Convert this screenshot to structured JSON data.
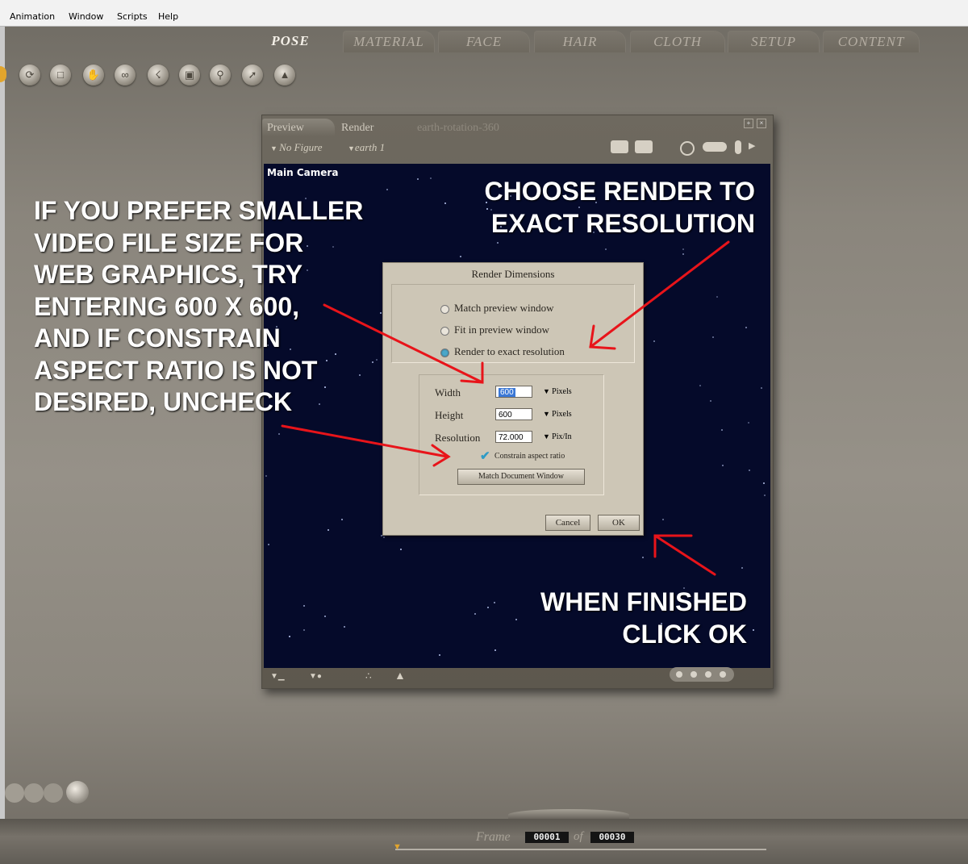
{
  "menu": [
    "Animation",
    "Window",
    "Scripts",
    "Help"
  ],
  "room_tabs": [
    {
      "label": "POSE",
      "active": true
    },
    {
      "label": "MATERIAL",
      "active": false
    },
    {
      "label": "FACE",
      "active": false
    },
    {
      "label": "HAIR",
      "active": false
    },
    {
      "label": "CLOTH",
      "active": false
    },
    {
      "label": "SETUP",
      "active": false
    },
    {
      "label": "CONTENT",
      "active": false
    }
  ],
  "tool_icons": [
    "rotate-icon",
    "grid-icon",
    "grab-icon",
    "chain-icon",
    "twist-icon",
    "translate-icon",
    "magnify-icon",
    "direct-manipulate-icon",
    "taper-icon"
  ],
  "doc_window": {
    "tabs": [
      "Preview",
      "Render"
    ],
    "doc_name": "earth-rotation-360",
    "figure_menu": "No Figure",
    "element_menu": "earth  1",
    "camera_label": "Main Camera"
  },
  "dialog": {
    "title": "Render Dimensions",
    "options": [
      {
        "label": "Match preview window",
        "selected": false
      },
      {
        "label": "Fit in preview window",
        "selected": false
      },
      {
        "label": "Render to exact resolution",
        "selected": true
      }
    ],
    "fields": [
      {
        "label": "Width",
        "value": "600",
        "unit": "Pixels"
      },
      {
        "label": "Height",
        "value": "600",
        "unit": "Pixels"
      },
      {
        "label": "Resolution",
        "value": "72.000",
        "unit": "Pix/In"
      }
    ],
    "constrain_label": "Constrain aspect ratio",
    "constrain_checked": true,
    "match_button": "Match Document Window",
    "cancel_button": "Cancel",
    "ok_button": "OK"
  },
  "annotations": {
    "left": [
      "IF YOU PREFER SMALLER",
      "VIDEO FILE SIZE FOR",
      "WEB GRAPHICS, TRY",
      "ENTERING 600 X 600,",
      "AND IF CONSTRAIN",
      "ASPECT RATIO IS NOT",
      "DESIRED, UNCHECK"
    ],
    "top_right": [
      "CHOOSE RENDER TO",
      "EXACT RESOLUTION"
    ],
    "bottom_right": [
      "WHEN FINISHED",
      "CLICK OK"
    ],
    "arrow_color": "#e8141a"
  },
  "timeline": {
    "frame_label": "Frame",
    "current": "00001",
    "of_label": "of",
    "total": "00030"
  }
}
